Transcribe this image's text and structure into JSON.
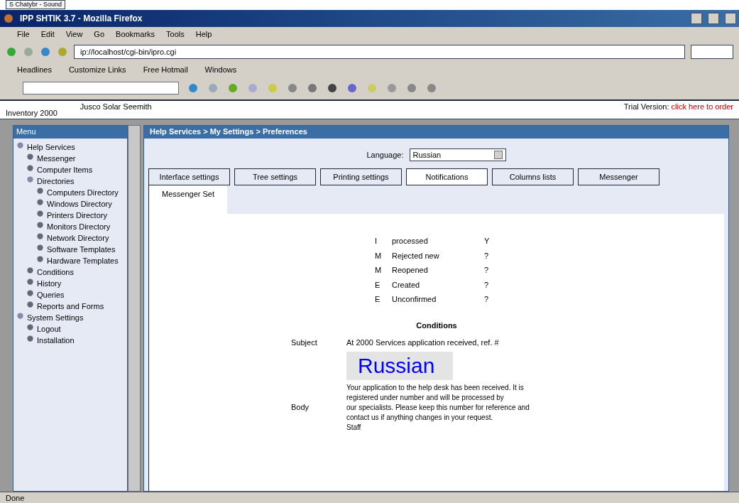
{
  "background_window": {
    "title": "S Chatybr - Sound"
  },
  "window": {
    "title": "IPP SHTIK 3.7 - Mozilla Firefox"
  },
  "menu_bar": [
    "File",
    "Edit",
    "View",
    "Go",
    "Bookmarks",
    "Tools",
    "Help"
  ],
  "address_bar": {
    "value": "ip://localhost/cgi-bin/ipro.cgi"
  },
  "bookmarks": [
    "Headlines",
    "Customize Links",
    "Free Hotmail",
    "Windows"
  ],
  "page_header": {
    "left": "Inventory 2000",
    "center": "Jusco Solar Seemith",
    "trial_label": "Trial Version:",
    "trial_link": "click here to order"
  },
  "sidebar": {
    "title": "Menu",
    "items": [
      {
        "label": "Help Services",
        "expanded": true,
        "children": [
          {
            "label": "Messenger"
          },
          {
            "label": "Computer Items"
          },
          {
            "label": "Directories",
            "expanded": true,
            "children": [
              {
                "label": "Computers Directory"
              },
              {
                "label": "Windows Directory"
              },
              {
                "label": "Printers Directory"
              },
              {
                "label": "Monitors Directory"
              },
              {
                "label": "Network Directory"
              },
              {
                "label": "Software Templates"
              },
              {
                "label": "Hardware Templates"
              }
            ]
          },
          {
            "label": "Conditions"
          },
          {
            "label": "History"
          },
          {
            "label": "Queries"
          },
          {
            "label": "Reports and Forms"
          }
        ]
      },
      {
        "label": "System Settings",
        "expanded": true,
        "children": [
          {
            "label": "Logout"
          },
          {
            "label": "Installation"
          }
        ]
      }
    ]
  },
  "panel": {
    "title": "Help Services > My Settings > Preferences",
    "language_label": "Language:",
    "language_value": "Russian",
    "tabs": [
      {
        "label": "Interface settings",
        "selected": false
      },
      {
        "label": "Tree settings",
        "selected": false
      },
      {
        "label": "Printing settings",
        "selected": false
      },
      {
        "label": "Notifications",
        "selected": true
      },
      {
        "label": "Columns lists",
        "selected": false
      },
      {
        "label": "Messenger",
        "selected": false
      }
    ],
    "subtab": "Messenger Set",
    "rows": [
      {
        "column_1": "I",
        "name": "processed",
        "column_3": "Y"
      },
      {
        "column_1": "M",
        "name": "Rejected new",
        "column_3": "?"
      },
      {
        "column_1": "M",
        "name": "Reopened",
        "column_3": "?"
      },
      {
        "column_1": "E",
        "name": "Created",
        "column_3": "?"
      },
      {
        "column_1": "E",
        "name": "Unconfirmed",
        "column_3": "?"
      }
    ],
    "conditions_title": "Conditions",
    "subject_label": "Subject",
    "subject_value": "At 2000 Services application received, ref. #",
    "body_label": "Body",
    "body_lines": [
      "Your application to the help desk has been received. It is",
      "registered under number and will be processed by",
      "our specialists. Please keep this number for reference and",
      "contact us if anything changes in your request.",
      "Staff"
    ],
    "overlay_label": "Russian"
  },
  "status_bar": {
    "text": "Done"
  }
}
